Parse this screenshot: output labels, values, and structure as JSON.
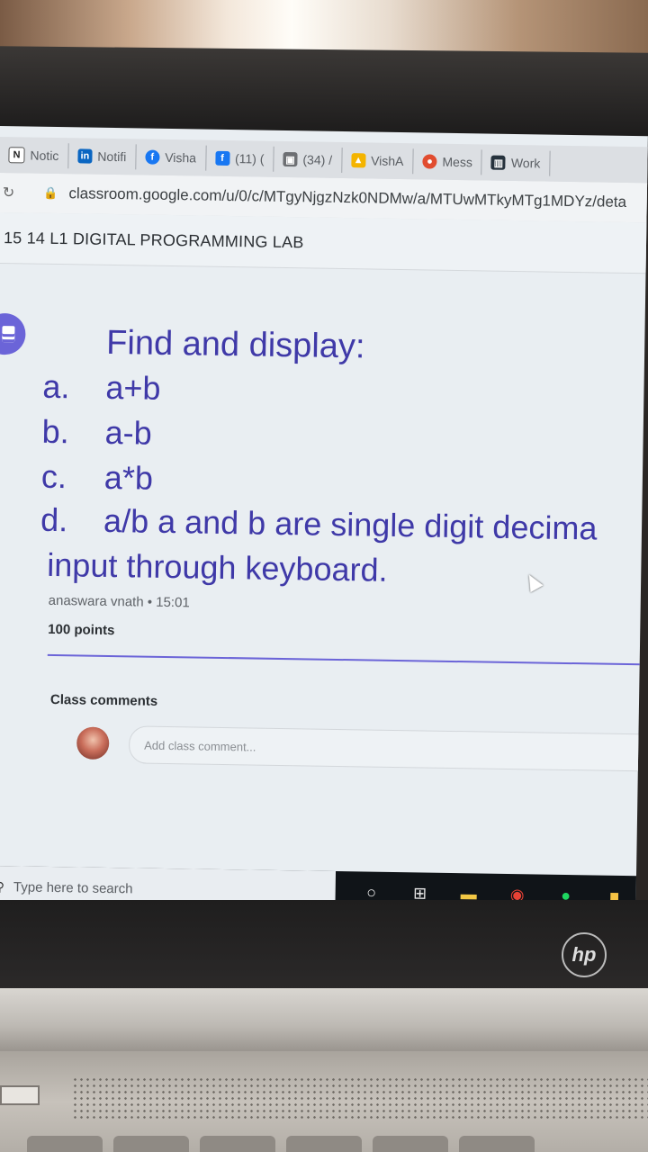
{
  "browser": {
    "tabs": [
      {
        "icon": "notion-icon",
        "label": "Notic",
        "color": "#ffffff"
      },
      {
        "icon": "linkedin-icon",
        "label": "Notifi",
        "color": "#0a66c2"
      },
      {
        "icon": "facebook-icon",
        "label": "Visha",
        "color": "#1877f2"
      },
      {
        "icon": "facebook-icon",
        "label": "(11) (",
        "color": "#1877f2"
      },
      {
        "icon": "image-icon",
        "label": "(34) /",
        "color": "#6d6f73"
      },
      {
        "icon": "drive-icon",
        "label": "VishA",
        "color": "#f4b400"
      },
      {
        "icon": "messenger-icon",
        "label": "Mess",
        "color": "#e14c2f"
      },
      {
        "icon": "trello-icon",
        "label": "Work",
        "color": "#26323d"
      }
    ],
    "url": "classroom.google.com/u/0/c/MTgyNjgzNzk0NDMw/a/MTUwMTkyMTg1MDYz/deta"
  },
  "classroom": {
    "class_title": "15 14 L1 DIGITAL PROGRAMMING LAB",
    "assignment": {
      "title": "Find and display:",
      "items": [
        {
          "letter": "a.",
          "text": "a+b"
        },
        {
          "letter": "b.",
          "text": "a-b"
        },
        {
          "letter": "c.",
          "text": "a*b"
        },
        {
          "letter": "d.",
          "text": "a/b  a and b are single digit decima"
        }
      ],
      "continuation": "input through keyboard.",
      "meta": "anaswara vnath • 15:01",
      "points": "100 points"
    },
    "comments": {
      "label": "Class comments",
      "placeholder": "Add class comment..."
    }
  },
  "taskbar": {
    "search_placeholder": "Type here to search",
    "icons": [
      "cortana-icon",
      "task-view-icon",
      "file-explorer-icon",
      "chrome-icon",
      "spotify-icon",
      "sticky-notes-icon"
    ]
  },
  "laptop": {
    "brand": "hp"
  },
  "colors": {
    "accent": "#3f39a8",
    "assignment_icon": "#6b64d8"
  }
}
